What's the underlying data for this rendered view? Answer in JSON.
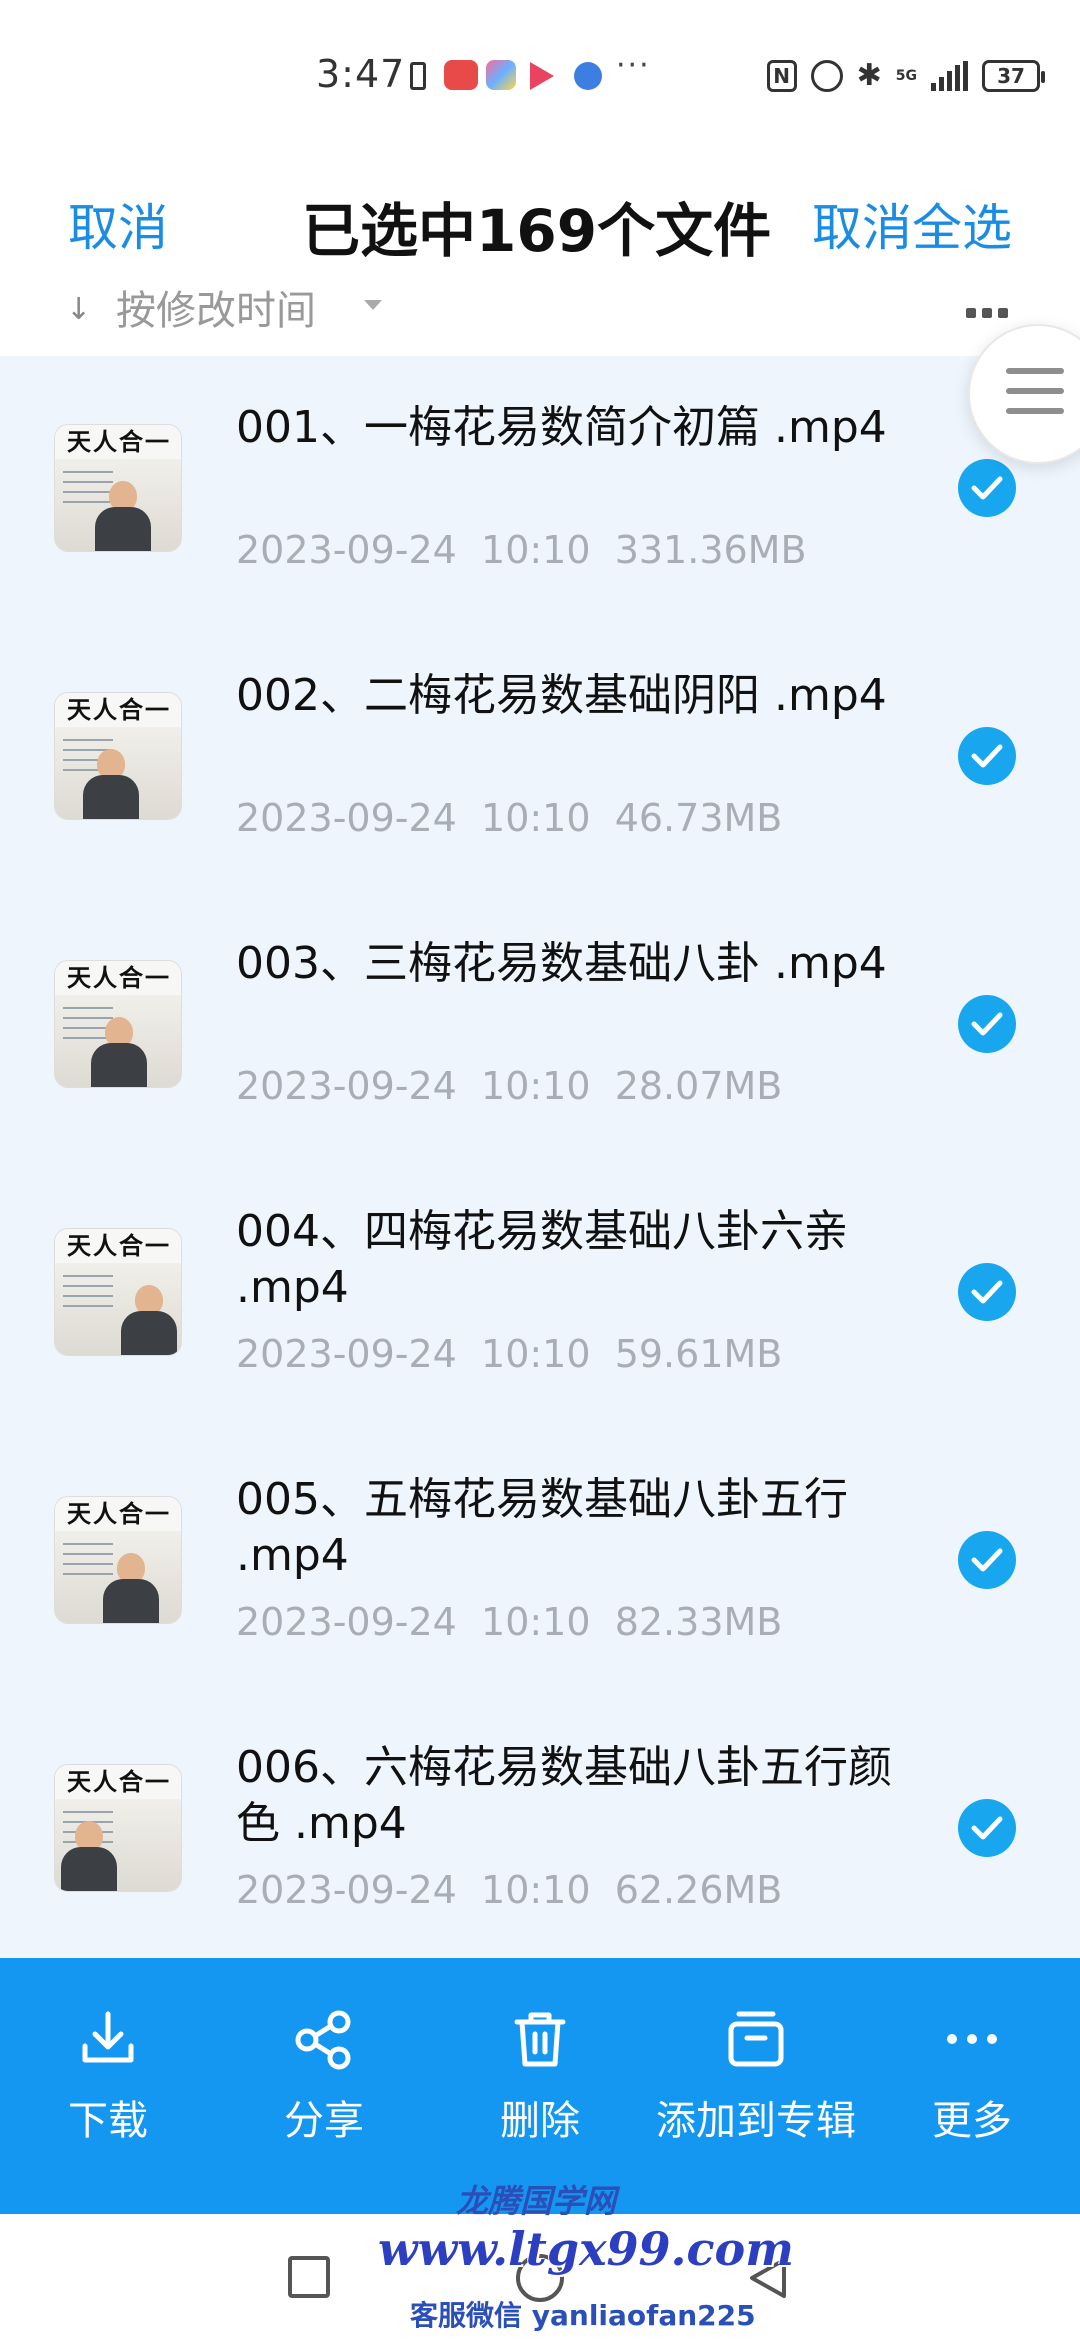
{
  "status_bar": {
    "time": "3:47",
    "battery_level": "37",
    "network": "5G"
  },
  "header": {
    "cancel_label": "取消",
    "title": "已选中169个文件",
    "deselect_all_label": "取消全选"
  },
  "sort": {
    "label": "按修改时间"
  },
  "files": [
    {
      "name": "001、一梅花易数简介初篇 .mp4",
      "date": "2023-09-24",
      "time": "10:10",
      "size": "331.36MB",
      "selected": true
    },
    {
      "name": "002、二梅花易数基础阴阳 .mp4",
      "date": "2023-09-24",
      "time": "10:10",
      "size": "46.73MB",
      "selected": true
    },
    {
      "name": "003、三梅花易数基础八卦 .mp4",
      "date": "2023-09-24",
      "time": "10:10",
      "size": "28.07MB",
      "selected": true
    },
    {
      "name": "004、四梅花易数基础八卦六亲 .mp4",
      "date": "2023-09-24",
      "time": "10:10",
      "size": "59.61MB",
      "selected": true
    },
    {
      "name": "005、五梅花易数基础八卦五行 .mp4",
      "date": "2023-09-24",
      "time": "10:10",
      "size": "82.33MB",
      "selected": true
    },
    {
      "name": "006、六梅花易数基础八卦五行颜色 .mp4",
      "date": "2023-09-24",
      "time": "10:10",
      "size": "62.26MB",
      "selected": true
    }
  ],
  "thumbnail_banner": "天人合一",
  "actions": [
    {
      "label": "下载",
      "icon": "download-icon"
    },
    {
      "label": "分享",
      "icon": "share-icon"
    },
    {
      "label": "删除",
      "icon": "trash-icon"
    },
    {
      "label": "添加到专辑",
      "icon": "album-icon"
    },
    {
      "label": "更多",
      "icon": "more-icon"
    }
  ],
  "watermark": {
    "site_name": "龙腾国学网",
    "url": "www.ltgx99.com",
    "contact": "客服微信 yanliaofan225"
  },
  "colors": {
    "accent": "#1a8ce3",
    "action_bar": "#1497f0",
    "check": "#18a7ee",
    "list_bg": "#eef5fd"
  }
}
